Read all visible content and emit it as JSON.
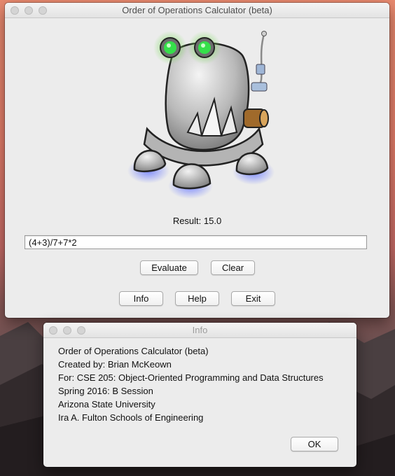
{
  "main_window": {
    "title": "Order of Operations Calculator (beta)",
    "result_text": "Result: 15.0",
    "expression_value": "(4+3)/7+7*2",
    "buttons": {
      "evaluate": "Evaluate",
      "clear": "Clear",
      "info": "Info",
      "help": "Help",
      "exit": "Exit"
    }
  },
  "info_window": {
    "title": "Info",
    "lines": [
      "Order of Operations Calculator (beta)",
      "Created by: Brian McKeown",
      "For: CSE 205: Object-Oriented Programming and Data Structures",
      "Spring 2016: B Session",
      "Arizona State University",
      "Ira A. Fulton Schools of Engineering"
    ],
    "ok_label": "OK"
  },
  "icons": {
    "robot": "robot-mascot-image",
    "window_controls": "traffic-light-buttons"
  },
  "colors": {
    "robot_eyes": "#35e04a",
    "window_bg": "#ececec",
    "desktop_top": "#e98a6f"
  }
}
